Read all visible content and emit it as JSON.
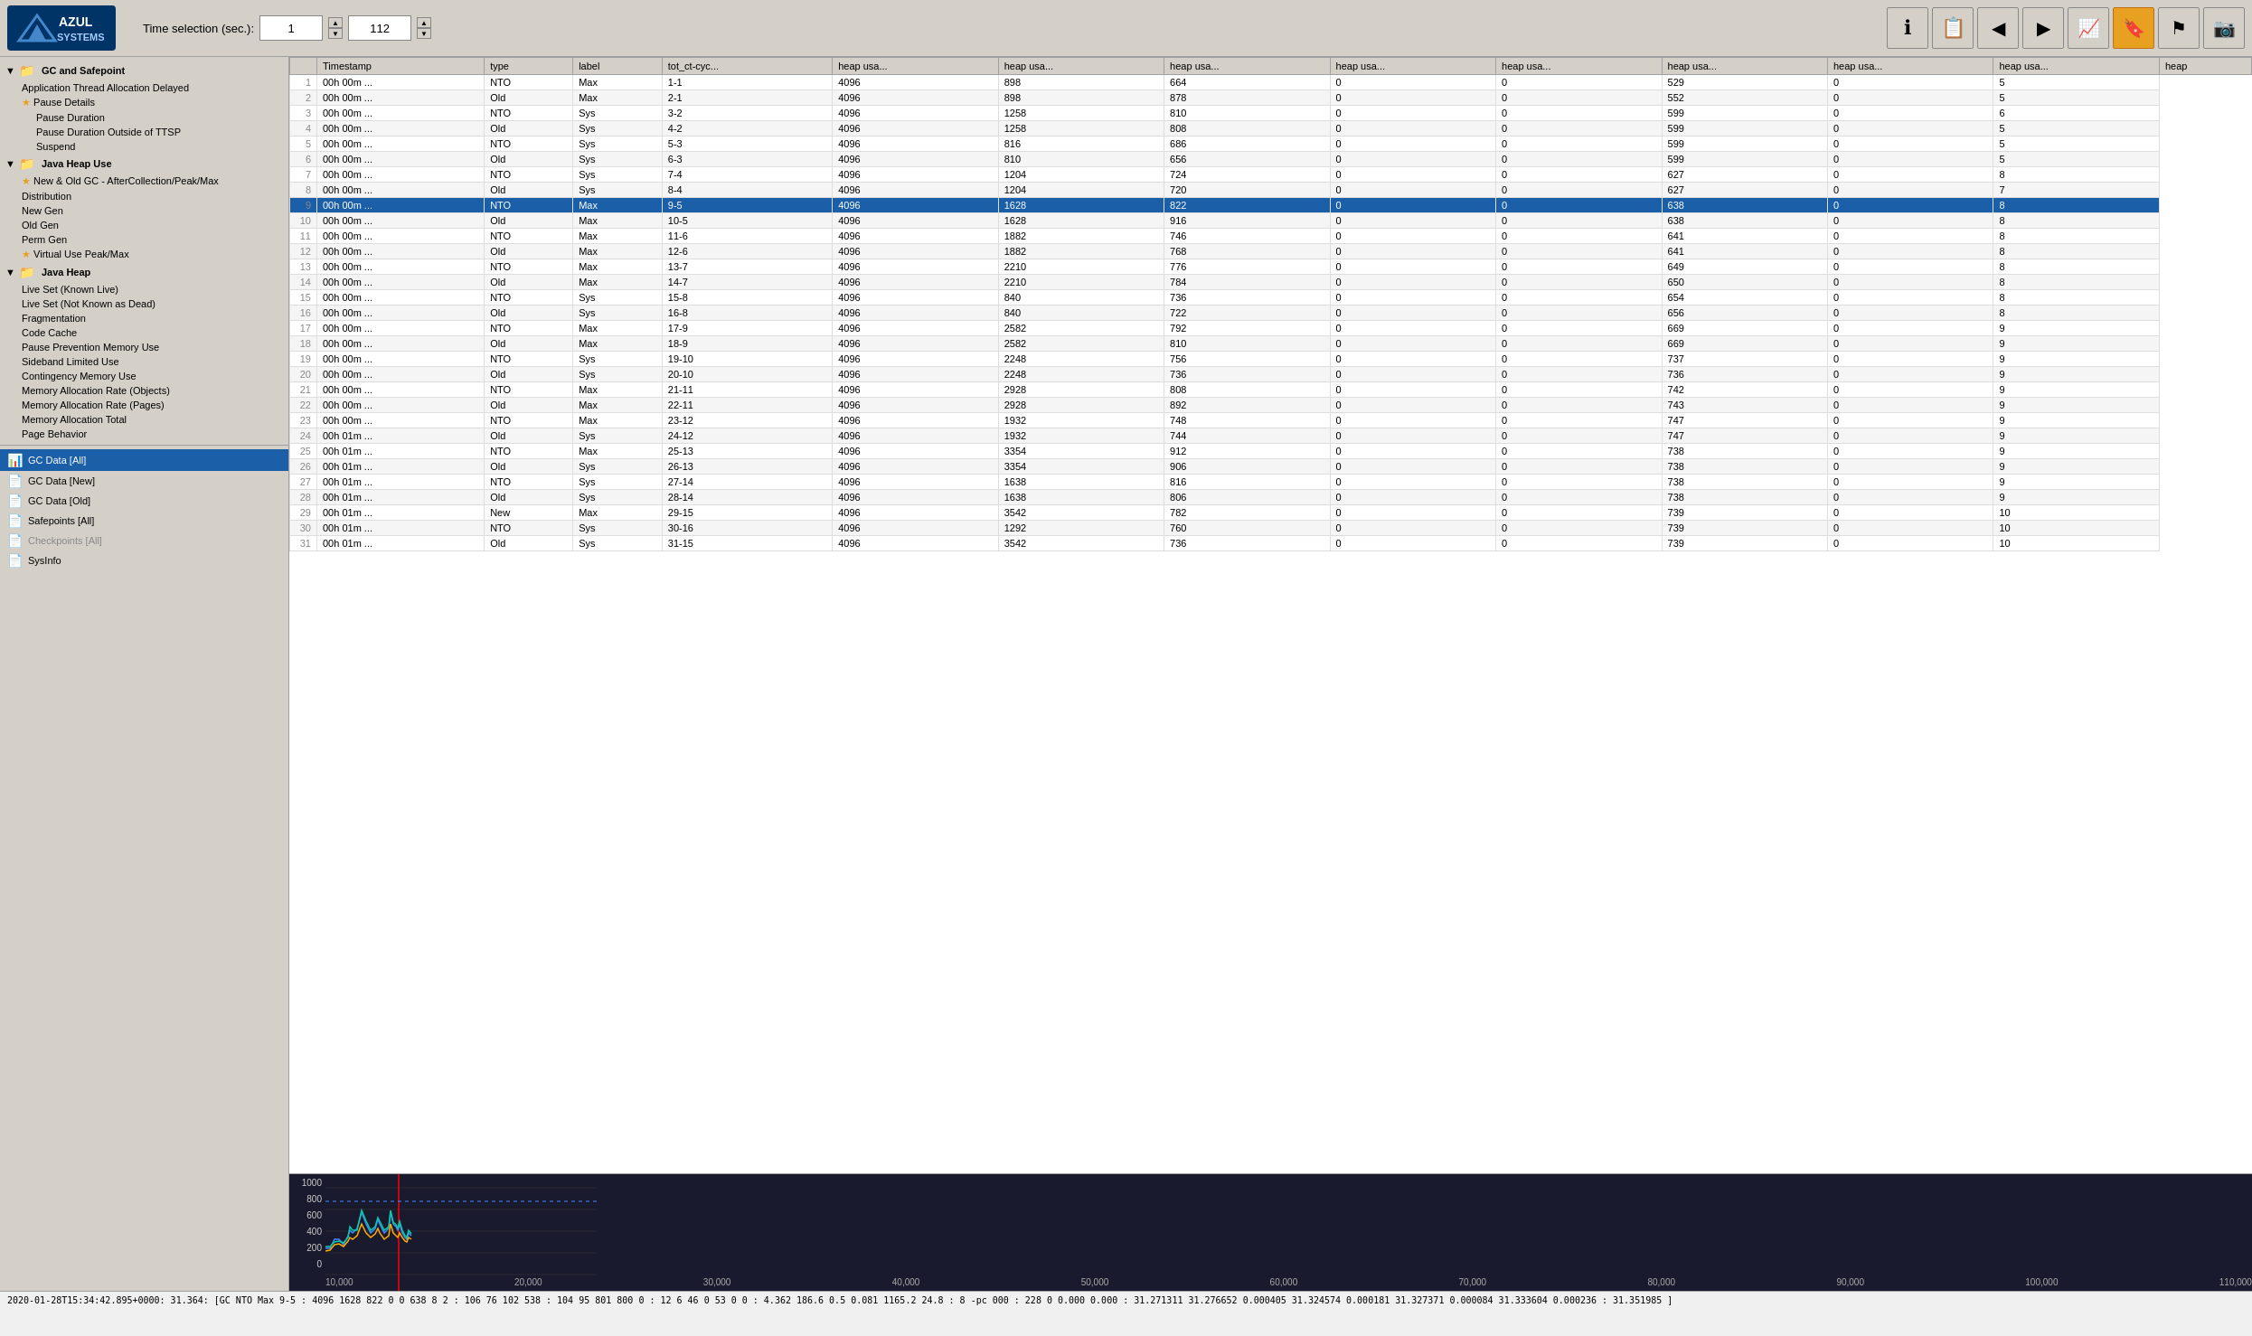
{
  "toolbar": {
    "logo_line1": "AZUL",
    "logo_line2": "SYSTEMS",
    "time_selection_label": "Time selection (sec.):",
    "time_value1": "1",
    "time_value2": "112",
    "icons": [
      {
        "name": "info-icon",
        "symbol": "ℹ",
        "active": false
      },
      {
        "name": "document-icon",
        "symbol": "📋",
        "active": false
      },
      {
        "name": "back-icon",
        "symbol": "◀",
        "active": false
      },
      {
        "name": "forward-icon",
        "symbol": "▶",
        "active": false
      },
      {
        "name": "chart-icon",
        "symbol": "📈",
        "active": false
      },
      {
        "name": "bookmark-icon",
        "symbol": "🔖",
        "active": true
      },
      {
        "name": "flag-icon",
        "symbol": "⚑",
        "active": false
      },
      {
        "name": "camera-icon",
        "symbol": "📷",
        "active": false
      }
    ]
  },
  "sidebar": {
    "sections": [
      {
        "label": "GC and Safepoint",
        "expanded": true,
        "items": [
          {
            "label": "Application Thread Allocation Delayed",
            "starred": false,
            "indent": 1
          },
          {
            "label": "Pause Details",
            "starred": true,
            "indent": 1
          },
          {
            "label": "Pause Duration",
            "starred": false,
            "indent": 2
          },
          {
            "label": "Pause Duration Outside of TTSP",
            "starred": false,
            "indent": 2
          },
          {
            "label": "Suspend",
            "starred": false,
            "indent": 2
          }
        ]
      },
      {
        "label": "Java Heap Use",
        "expanded": true,
        "items": [
          {
            "label": "New & Old GC - AfterCollection/Peak/Max",
            "starred": true,
            "indent": 1
          },
          {
            "label": "Distribution",
            "starred": false,
            "indent": 1
          },
          {
            "label": "New Gen",
            "starred": false,
            "indent": 1
          },
          {
            "label": "Old Gen",
            "starred": false,
            "indent": 1
          },
          {
            "label": "Perm Gen",
            "starred": false,
            "indent": 1
          },
          {
            "label": "Virtual Use Peak/Max",
            "starred": true,
            "indent": 1
          }
        ]
      },
      {
        "label": "Java Heap",
        "expanded": true,
        "items": [
          {
            "label": "Live Set (Known Live)",
            "starred": false,
            "indent": 1
          },
          {
            "label": "Live Set (Not Known as Dead)",
            "starred": false,
            "indent": 1
          },
          {
            "label": "Fragmentation",
            "starred": false,
            "indent": 1
          },
          {
            "label": "Code Cache",
            "starred": false,
            "indent": 1
          },
          {
            "label": "Pause Prevention Memory Use",
            "starred": false,
            "indent": 1
          },
          {
            "label": "Sideband Limited Use",
            "starred": false,
            "indent": 1
          },
          {
            "label": "Contingency Memory Use",
            "starred": false,
            "indent": 1
          },
          {
            "label": "Memory Allocation Rate (Objects)",
            "starred": false,
            "indent": 1
          },
          {
            "label": "Memory Allocation Rate (Pages)",
            "starred": false,
            "indent": 1
          },
          {
            "label": "Memory Allocation Total",
            "starred": false,
            "indent": 1
          },
          {
            "label": "Page Behavior",
            "starred": false,
            "indent": 1
          }
        ]
      }
    ],
    "bottom_items": [
      {
        "label": "GC Data [All]",
        "active": true,
        "icon": "📊"
      },
      {
        "label": "GC Data [New]",
        "active": false,
        "icon": "📄"
      },
      {
        "label": "GC Data [Old]",
        "active": false,
        "icon": "📄"
      },
      {
        "label": "Safepoints [All]",
        "active": false,
        "icon": "📄"
      },
      {
        "label": "Checkpoints [All]",
        "active": false,
        "icon": "📄"
      },
      {
        "label": "SysInfo",
        "active": false,
        "icon": "📄"
      }
    ]
  },
  "table": {
    "columns": [
      "",
      "Timestamp",
      "type",
      "label",
      "tot_ct-cyc...",
      "heap usa...",
      "heap usa...",
      "heap usa...",
      "heap usa...",
      "heap usa...",
      "heap usa...",
      "heap usa...",
      "heap usa...",
      "heap"
    ],
    "rows": [
      {
        "num": "1",
        "timestamp": "00h 00m ...",
        "type": "NTO",
        "label": "Max",
        "col5": "1-1",
        "col6": "4096",
        "col7": "898",
        "col8": "664",
        "col9": "0",
        "col10": "0",
        "col11": "529",
        "col12": "0",
        "col13": "5"
      },
      {
        "num": "2",
        "timestamp": "00h 00m ...",
        "type": "Old",
        "label": "Max",
        "col5": "2-1",
        "col6": "4096",
        "col7": "898",
        "col8": "878",
        "col9": "0",
        "col10": "0",
        "col11": "552",
        "col12": "0",
        "col13": "5"
      },
      {
        "num": "3",
        "timestamp": "00h 00m ...",
        "type": "NTO",
        "label": "Sys",
        "col5": "3-2",
        "col6": "4096",
        "col7": "1258",
        "col8": "810",
        "col9": "0",
        "col10": "0",
        "col11": "599",
        "col12": "0",
        "col13": "6"
      },
      {
        "num": "4",
        "timestamp": "00h 00m ...",
        "type": "Old",
        "label": "Sys",
        "col5": "4-2",
        "col6": "4096",
        "col7": "1258",
        "col8": "808",
        "col9": "0",
        "col10": "0",
        "col11": "599",
        "col12": "0",
        "col13": "5"
      },
      {
        "num": "5",
        "timestamp": "00h 00m ...",
        "type": "NTO",
        "label": "Sys",
        "col5": "5-3",
        "col6": "4096",
        "col7": "816",
        "col8": "686",
        "col9": "0",
        "col10": "0",
        "col11": "599",
        "col12": "0",
        "col13": "5"
      },
      {
        "num": "6",
        "timestamp": "00h 00m ...",
        "type": "Old",
        "label": "Sys",
        "col5": "6-3",
        "col6": "4096",
        "col7": "810",
        "col8": "656",
        "col9": "0",
        "col10": "0",
        "col11": "599",
        "col12": "0",
        "col13": "5"
      },
      {
        "num": "7",
        "timestamp": "00h 00m ...",
        "type": "NTO",
        "label": "Sys",
        "col5": "7-4",
        "col6": "4096",
        "col7": "1204",
        "col8": "724",
        "col9": "0",
        "col10": "0",
        "col11": "627",
        "col12": "0",
        "col13": "8"
      },
      {
        "num": "8",
        "timestamp": "00h 00m ...",
        "type": "Old",
        "label": "Sys",
        "col5": "8-4",
        "col6": "4096",
        "col7": "1204",
        "col8": "720",
        "col9": "0",
        "col10": "0",
        "col11": "627",
        "col12": "0",
        "col13": "7"
      },
      {
        "num": "9",
        "timestamp": "00h 00m ...",
        "type": "NTO",
        "label": "Max",
        "col5": "9-5",
        "col6": "4096",
        "col7": "1628",
        "col8": "822",
        "col9": "0",
        "col10": "0",
        "col11": "638",
        "col12": "0",
        "col13": "8",
        "selected": true
      },
      {
        "num": "10",
        "timestamp": "00h 00m ...",
        "type": "Old",
        "label": "Max",
        "col5": "10-5",
        "col6": "4096",
        "col7": "1628",
        "col8": "916",
        "col9": "0",
        "col10": "0",
        "col11": "638",
        "col12": "0",
        "col13": "8"
      },
      {
        "num": "11",
        "timestamp": "00h 00m ...",
        "type": "NTO",
        "label": "Max",
        "col5": "11-6",
        "col6": "4096",
        "col7": "1882",
        "col8": "746",
        "col9": "0",
        "col10": "0",
        "col11": "641",
        "col12": "0",
        "col13": "8"
      },
      {
        "num": "12",
        "timestamp": "00h 00m ...",
        "type": "Old",
        "label": "Max",
        "col5": "12-6",
        "col6": "4096",
        "col7": "1882",
        "col8": "768",
        "col9": "0",
        "col10": "0",
        "col11": "641",
        "col12": "0",
        "col13": "8"
      },
      {
        "num": "13",
        "timestamp": "00h 00m ...",
        "type": "NTO",
        "label": "Max",
        "col5": "13-7",
        "col6": "4096",
        "col7": "2210",
        "col8": "776",
        "col9": "0",
        "col10": "0",
        "col11": "649",
        "col12": "0",
        "col13": "8"
      },
      {
        "num": "14",
        "timestamp": "00h 00m ...",
        "type": "Old",
        "label": "Max",
        "col5": "14-7",
        "col6": "4096",
        "col7": "2210",
        "col8": "784",
        "col9": "0",
        "col10": "0",
        "col11": "650",
        "col12": "0",
        "col13": "8"
      },
      {
        "num": "15",
        "timestamp": "00h 00m ...",
        "type": "NTO",
        "label": "Sys",
        "col5": "15-8",
        "col6": "4096",
        "col7": "840",
        "col8": "736",
        "col9": "0",
        "col10": "0",
        "col11": "654",
        "col12": "0",
        "col13": "8"
      },
      {
        "num": "16",
        "timestamp": "00h 00m ...",
        "type": "Old",
        "label": "Sys",
        "col5": "16-8",
        "col6": "4096",
        "col7": "840",
        "col8": "722",
        "col9": "0",
        "col10": "0",
        "col11": "656",
        "col12": "0",
        "col13": "8"
      },
      {
        "num": "17",
        "timestamp": "00h 00m ...",
        "type": "NTO",
        "label": "Max",
        "col5": "17-9",
        "col6": "4096",
        "col7": "2582",
        "col8": "792",
        "col9": "0",
        "col10": "0",
        "col11": "669",
        "col12": "0",
        "col13": "9"
      },
      {
        "num": "18",
        "timestamp": "00h 00m ...",
        "type": "Old",
        "label": "Max",
        "col5": "18-9",
        "col6": "4096",
        "col7": "2582",
        "col8": "810",
        "col9": "0",
        "col10": "0",
        "col11": "669",
        "col12": "0",
        "col13": "9"
      },
      {
        "num": "19",
        "timestamp": "00h 00m ...",
        "type": "NTO",
        "label": "Sys",
        "col5": "19-10",
        "col6": "4096",
        "col7": "2248",
        "col8": "756",
        "col9": "0",
        "col10": "0",
        "col11": "737",
        "col12": "0",
        "col13": "9"
      },
      {
        "num": "20",
        "timestamp": "00h 00m ...",
        "type": "Old",
        "label": "Sys",
        "col5": "20-10",
        "col6": "4096",
        "col7": "2248",
        "col8": "736",
        "col9": "0",
        "col10": "0",
        "col11": "736",
        "col12": "0",
        "col13": "9"
      },
      {
        "num": "21",
        "timestamp": "00h 00m ...",
        "type": "NTO",
        "label": "Max",
        "col5": "21-11",
        "col6": "4096",
        "col7": "2928",
        "col8": "808",
        "col9": "0",
        "col10": "0",
        "col11": "742",
        "col12": "0",
        "col13": "9"
      },
      {
        "num": "22",
        "timestamp": "00h 00m ...",
        "type": "Old",
        "label": "Max",
        "col5": "22-11",
        "col6": "4096",
        "col7": "2928",
        "col8": "892",
        "col9": "0",
        "col10": "0",
        "col11": "743",
        "col12": "0",
        "col13": "9"
      },
      {
        "num": "23",
        "timestamp": "00h 00m ...",
        "type": "NTO",
        "label": "Max",
        "col5": "23-12",
        "col6": "4096",
        "col7": "1932",
        "col8": "748",
        "col9": "0",
        "col10": "0",
        "col11": "747",
        "col12": "0",
        "col13": "9"
      },
      {
        "num": "24",
        "timestamp": "00h 01m ...",
        "type": "Old",
        "label": "Sys",
        "col5": "24-12",
        "col6": "4096",
        "col7": "1932",
        "col8": "744",
        "col9": "0",
        "col10": "0",
        "col11": "747",
        "col12": "0",
        "col13": "9"
      },
      {
        "num": "25",
        "timestamp": "00h 01m ...",
        "type": "NTO",
        "label": "Max",
        "col5": "25-13",
        "col6": "4096",
        "col7": "3354",
        "col8": "912",
        "col9": "0",
        "col10": "0",
        "col11": "738",
        "col12": "0",
        "col13": "9"
      },
      {
        "num": "26",
        "timestamp": "00h 01m ...",
        "type": "Old",
        "label": "Sys",
        "col5": "26-13",
        "col6": "4096",
        "col7": "3354",
        "col8": "906",
        "col9": "0",
        "col10": "0",
        "col11": "738",
        "col12": "0",
        "col13": "9"
      },
      {
        "num": "27",
        "timestamp": "00h 01m ...",
        "type": "NTO",
        "label": "Sys",
        "col5": "27-14",
        "col6": "4096",
        "col7": "1638",
        "col8": "816",
        "col9": "0",
        "col10": "0",
        "col11": "738",
        "col12": "0",
        "col13": "9"
      },
      {
        "num": "28",
        "timestamp": "00h 01m ...",
        "type": "Old",
        "label": "Sys",
        "col5": "28-14",
        "col6": "4096",
        "col7": "1638",
        "col8": "806",
        "col9": "0",
        "col10": "0",
        "col11": "738",
        "col12": "0",
        "col13": "9"
      },
      {
        "num": "29",
        "timestamp": "00h 01m ...",
        "type": "New",
        "label": "Max",
        "col5": "29-15",
        "col6": "4096",
        "col7": "3542",
        "col8": "782",
        "col9": "0",
        "col10": "0",
        "col11": "739",
        "col12": "0",
        "col13": "10"
      },
      {
        "num": "30",
        "timestamp": "00h 01m ...",
        "type": "NTO",
        "label": "Sys",
        "col5": "30-16",
        "col6": "4096",
        "col7": "1292",
        "col8": "760",
        "col9": "0",
        "col10": "0",
        "col11": "739",
        "col12": "0",
        "col13": "10"
      },
      {
        "num": "31",
        "timestamp": "00h 01m ...",
        "type": "Old",
        "label": "Sys",
        "col5": "31-15",
        "col6": "4096",
        "col7": "3542",
        "col8": "736",
        "col9": "0",
        "col10": "0",
        "col11": "739",
        "col12": "0",
        "col13": "10"
      }
    ]
  },
  "chart": {
    "y_labels": [
      "1000",
      "800",
      "600",
      "400",
      "200",
      "0"
    ],
    "x_labels": [
      "10,000",
      "20,000",
      "30,000",
      "40,000",
      "50,000",
      "60,000",
      "70,000",
      "80,000",
      "90,000",
      "100,000",
      "110,000"
    ]
  },
  "status_bar": {
    "text": "2020-01-28T15:34:42.895+0000: 31.364: [GC NTO Max 9-5 : 4096 1628 822 0 0 638 8 2 : 106 76 102 538 : 104 95 801 800 0 : 12 6 46 0 53 0 0 : 4.362 186.6 0.5 0.081 1165.2 24.8 : 8 -pc 000 : 228 0 0.000 0.000 : 31.271311 31.276652 0.000405 31.324574 0.000181 31.327371 0.000084 31.333604 0.000236 : 31.351985 ]"
  }
}
